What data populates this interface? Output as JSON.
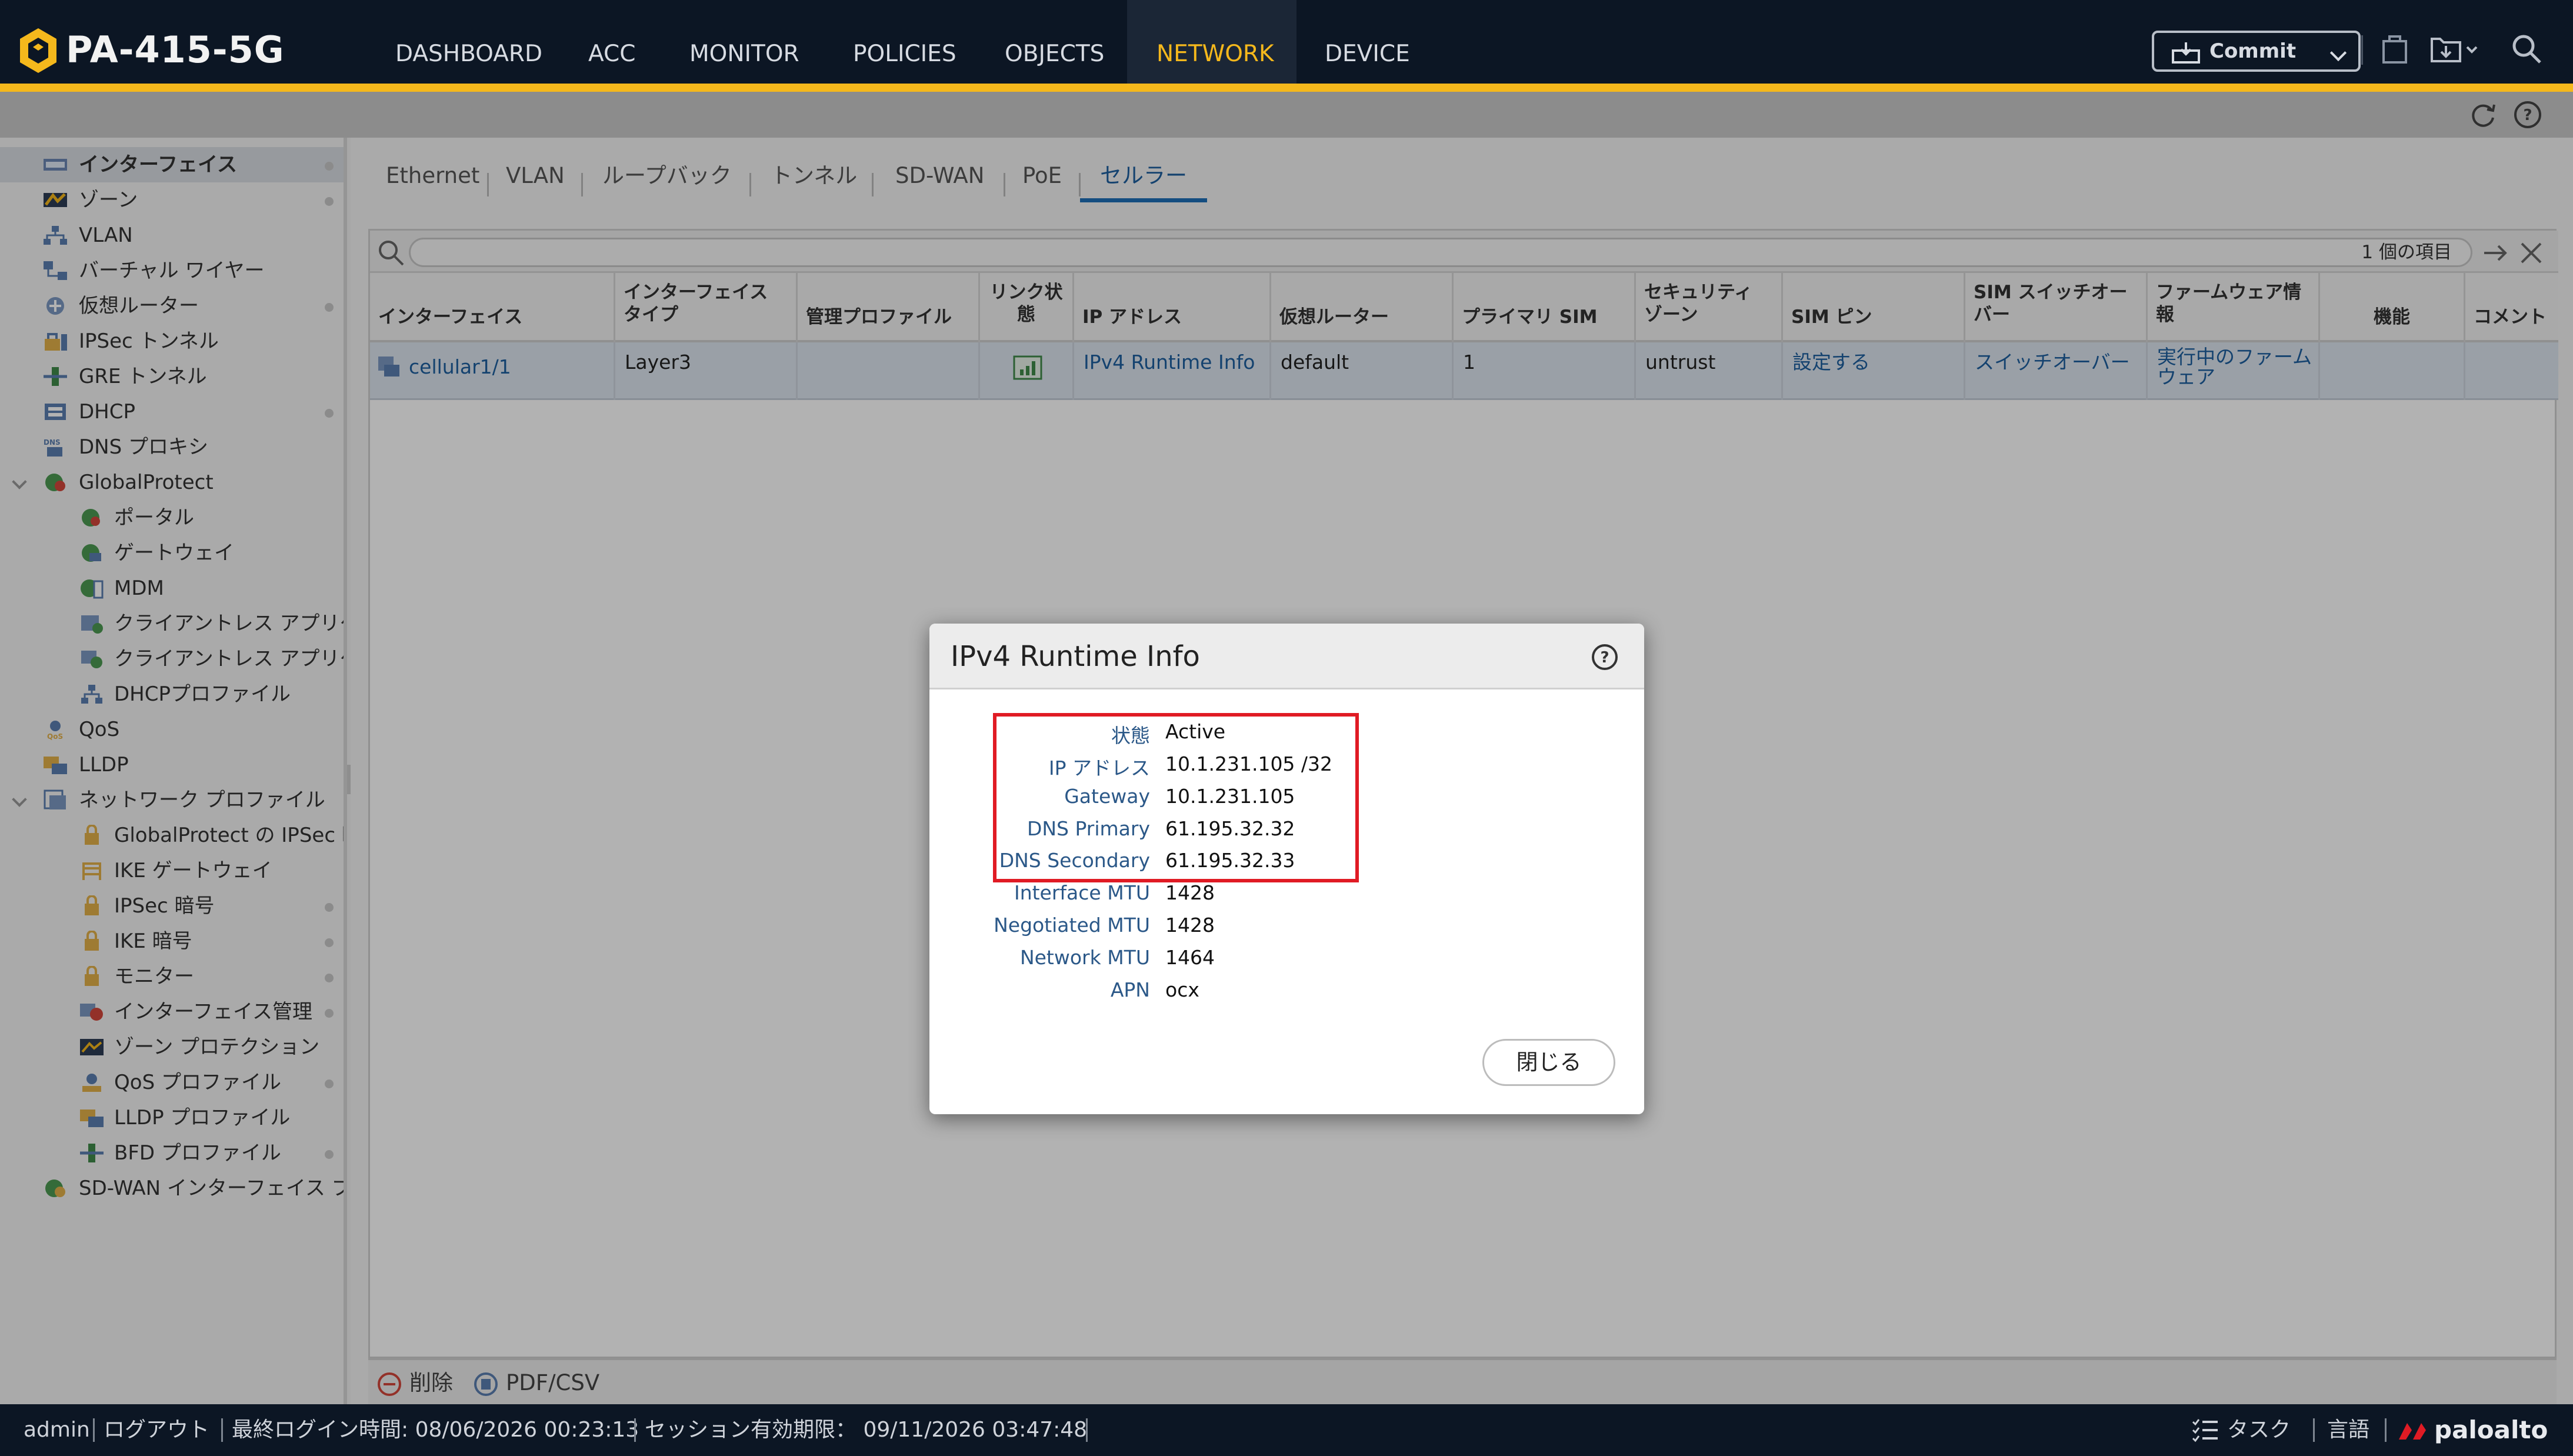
{
  "app": {
    "brand": "PA-415-5G"
  },
  "nav": {
    "items": [
      "DASHBOARD",
      "ACC",
      "MONITOR",
      "POLICIES",
      "OBJECTS",
      "NETWORK",
      "DEVICE"
    ],
    "active": "NETWORK",
    "commit_label": "Commit"
  },
  "sidebar": {
    "items": [
      {
        "label": "インターフェイス",
        "icon": "interface-icon"
      },
      {
        "label": "ゾーン",
        "icon": "zone-icon"
      },
      {
        "label": "VLAN",
        "icon": "vlan-icon"
      },
      {
        "label": "バーチャル ワイヤー",
        "icon": "virtual-wire-icon"
      },
      {
        "label": "仮想ルーター",
        "icon": "virtual-router-icon"
      },
      {
        "label": "IPSec トンネル",
        "icon": "ipsec-tunnel-icon"
      },
      {
        "label": "GRE トンネル",
        "icon": "gre-tunnel-icon"
      },
      {
        "label": "DHCP",
        "icon": "dhcp-icon"
      },
      {
        "label": "DNS プロキシ",
        "icon": "dns-proxy-icon"
      },
      {
        "label": "GlobalProtect",
        "icon": "globalprotect-icon"
      },
      {
        "label": "ポータル",
        "icon": "portal-icon"
      },
      {
        "label": "ゲートウェイ",
        "icon": "gateway-icon"
      },
      {
        "label": "MDM",
        "icon": "mdm-icon"
      },
      {
        "label": "クライアントレス アプリケ",
        "icon": "clientless-app-icon"
      },
      {
        "label": "クライアントレス アプリケ",
        "icon": "clientless-app-group-icon"
      },
      {
        "label": "DHCPプロファイル",
        "icon": "dhcp-profile-icon"
      },
      {
        "label": "QoS",
        "icon": "qos-icon"
      },
      {
        "label": "LLDP",
        "icon": "lldp-icon"
      },
      {
        "label": "ネットワーク プロファイル",
        "icon": "network-profile-icon"
      },
      {
        "label": "GlobalProtect の IPSec 暗号",
        "icon": "lock-icon"
      },
      {
        "label": "IKE ゲートウェイ",
        "icon": "ike-gateway-icon"
      },
      {
        "label": "IPSec 暗号",
        "icon": "lock-icon"
      },
      {
        "label": "IKE 暗号",
        "icon": "lock-icon"
      },
      {
        "label": "モニター",
        "icon": "monitor-icon"
      },
      {
        "label": "インターフェイス管理",
        "icon": "interface-mgmt-icon"
      },
      {
        "label": "ゾーン プロテクション",
        "icon": "zone-protection-icon"
      },
      {
        "label": "QoS プロファイル",
        "icon": "qos-profile-icon"
      },
      {
        "label": "LLDP プロファイル",
        "icon": "lldp-profile-icon"
      },
      {
        "label": "BFD プロファイル",
        "icon": "bfd-profile-icon"
      },
      {
        "label": "SD-WAN インターフェイス プロ",
        "icon": "sdwan-icon"
      }
    ]
  },
  "tabs": [
    "Ethernet",
    "VLAN",
    "ループバック",
    "トンネル",
    "SD-WAN",
    "PoE",
    "セルラー"
  ],
  "active_tab": "セルラー",
  "grid": {
    "item_count": "1 個の項目",
    "columns": [
      [
        "インターフェイス"
      ],
      [
        "インターフェイス",
        "タイプ"
      ],
      [
        "管理プロファイル"
      ],
      [
        "リンク状",
        "態"
      ],
      [
        "IP アドレス"
      ],
      [
        "仮想ルーター"
      ],
      [
        "プライマリ SIM"
      ],
      [
        "セキュリティ",
        "ゾーン"
      ],
      [
        "SIM ピン"
      ],
      [
        "SIM スイッチオー",
        "バー"
      ],
      [
        "ファームウェア情",
        "報"
      ],
      [
        "機能"
      ],
      [
        "コメント"
      ]
    ],
    "row": {
      "interface": "cellular1/1",
      "type": "Layer3",
      "mgmt_profile": "",
      "ip_address": "IPv4 Runtime Info",
      "virtual_router": "default",
      "primary_sim": "1",
      "security_zone": "untrust",
      "sim_pin": "設定する",
      "sim_switchover": "スイッチオーバー",
      "firmware": [
        "実行中のファーム",
        "ウェア"
      ]
    }
  },
  "footer": {
    "delete_label": "削除",
    "pdf_label": "PDF/CSV"
  },
  "dialog": {
    "title": "IPv4 Runtime Info",
    "fields": [
      {
        "label": "状態",
        "value": "Active"
      },
      {
        "label": "IP アドレス",
        "value": "10.1.231.105 /32"
      },
      {
        "label": "Gateway",
        "value": "10.1.231.105"
      },
      {
        "label": "DNS Primary",
        "value": "61.195.32.32"
      },
      {
        "label": "DNS Secondary",
        "value": "61.195.32.33"
      },
      {
        "label": "Interface MTU",
        "value": "1428"
      },
      {
        "label": "Negotiated MTU",
        "value": "1428"
      },
      {
        "label": "Network MTU",
        "value": "1464"
      },
      {
        "label": "APN",
        "value": "ocx"
      }
    ],
    "close_label": "閉じる"
  },
  "status_bar": {
    "user": "admin",
    "logout": "ログアウト",
    "last_login": "最終ログイン時間: 08/06/2026 00:23:13",
    "session_expiry": "セッション有効期限： 09/11/2026 03:47:48",
    "tasks": "タスク",
    "language": "言語",
    "vendor": "paloalto"
  },
  "colors": {
    "accent": "#f5b81c",
    "topbar": "#0c1624",
    "link": "#1d5f9f",
    "highlight_box": "#e01b24"
  }
}
